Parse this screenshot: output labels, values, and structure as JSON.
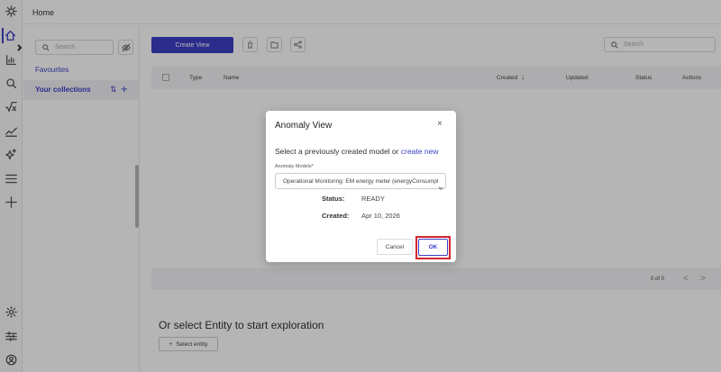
{
  "topbar": {
    "title": "Home"
  },
  "rail": {
    "icons": [
      "logo-icon",
      "home-icon",
      "bar-chart-icon",
      "search-icon",
      "sqrt-icon",
      "trend-icon",
      "sparkle-icon",
      "list-icon",
      "plus-icon",
      "settings-icon",
      "sliders-icon",
      "user-icon"
    ]
  },
  "sidepanel": {
    "search_placeholder": "Search",
    "favourites": "Favourites",
    "collections": "Your collections"
  },
  "main": {
    "create_view": "Create View",
    "search_placeholder": "Search",
    "columns": [
      "Type",
      "Name",
      "Created",
      "Updated",
      "Status",
      "Actions"
    ],
    "pagination": "0 of 0",
    "prev": "<",
    "next": ">",
    "explore_title": "Or select Entity to start exploration",
    "select_entity": "Select entity",
    "select_entity_plus": "+"
  },
  "modal": {
    "title": "Anomaly View",
    "close": "×",
    "prompt": "Select a previously created model or",
    "prompt_link": "create new",
    "field_label": "Anomaly Models*",
    "selected_model": "Operational Monitoring: EM energy meter (energyConsumption)",
    "status_label": "Status:",
    "status_value": "READY",
    "created_label": "Created:",
    "created_value": "Apr 10, 2026",
    "cancel": "Cancel",
    "ok": "OK"
  },
  "colors": {
    "accent": "#3d3fc6",
    "highlight": "#d4252b"
  }
}
